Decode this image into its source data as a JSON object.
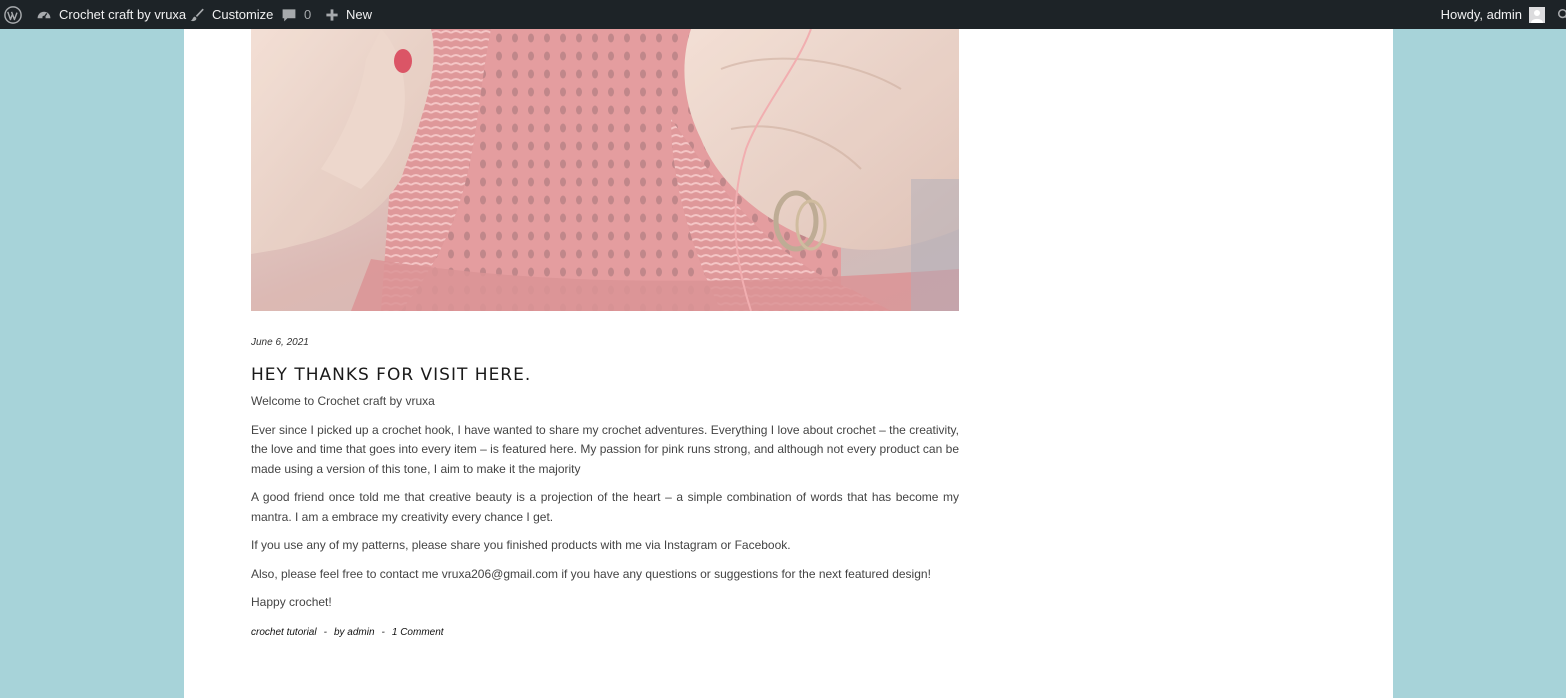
{
  "admin_bar": {
    "site_name": "Crochet craft by vruxa",
    "customize_label": "Customize",
    "comments_count": "0",
    "new_label": "New",
    "greeting": "Howdy, admin",
    "icons": {
      "wp_logo": "wordpress-icon",
      "site": "dashboard-icon",
      "customize": "brush-icon",
      "comments": "comment-icon",
      "new": "plus-icon",
      "avatar": "avatar-icon",
      "search": "search-icon"
    },
    "colors": {
      "background": "#1d2327",
      "text": "#f0f0f1",
      "muted": "#a7aaad"
    }
  },
  "page": {
    "background_color": "#a7d3d9",
    "content_background": "#ffffff"
  },
  "post": {
    "featured_image": "crochet-pink-lace-hands-photo",
    "date": "June 6, 2021",
    "title": "HEY THANKS FOR VISIT HERE.",
    "paragraphs": [
      "Welcome to Crochet craft by vruxa",
      "Ever since I picked up a crochet hook, I have wanted to share my crochet adventures. Everything I love about crochet – the creativity, the love and time that goes into every item – is featured here. My passion for pink runs strong, and although not every product can be made using a version of this tone, I aim to make it the majority",
      "A good friend once told me that creative beauty is a projection of the heart – a simple combination of words that has become my mantra. I am a embrace my creativity every chance I get.",
      "If you use any of my patterns, please share you finished products with me via Instagram or Facebook.",
      "Also, please feel free to contact me vruxa206@gmail.com if you have any questions or suggestions for the next featured design!",
      "Happy crochet!"
    ],
    "meta": {
      "category": "crochet tutorial",
      "separator": "-",
      "author": "by admin",
      "comments": "1 Comment"
    }
  }
}
